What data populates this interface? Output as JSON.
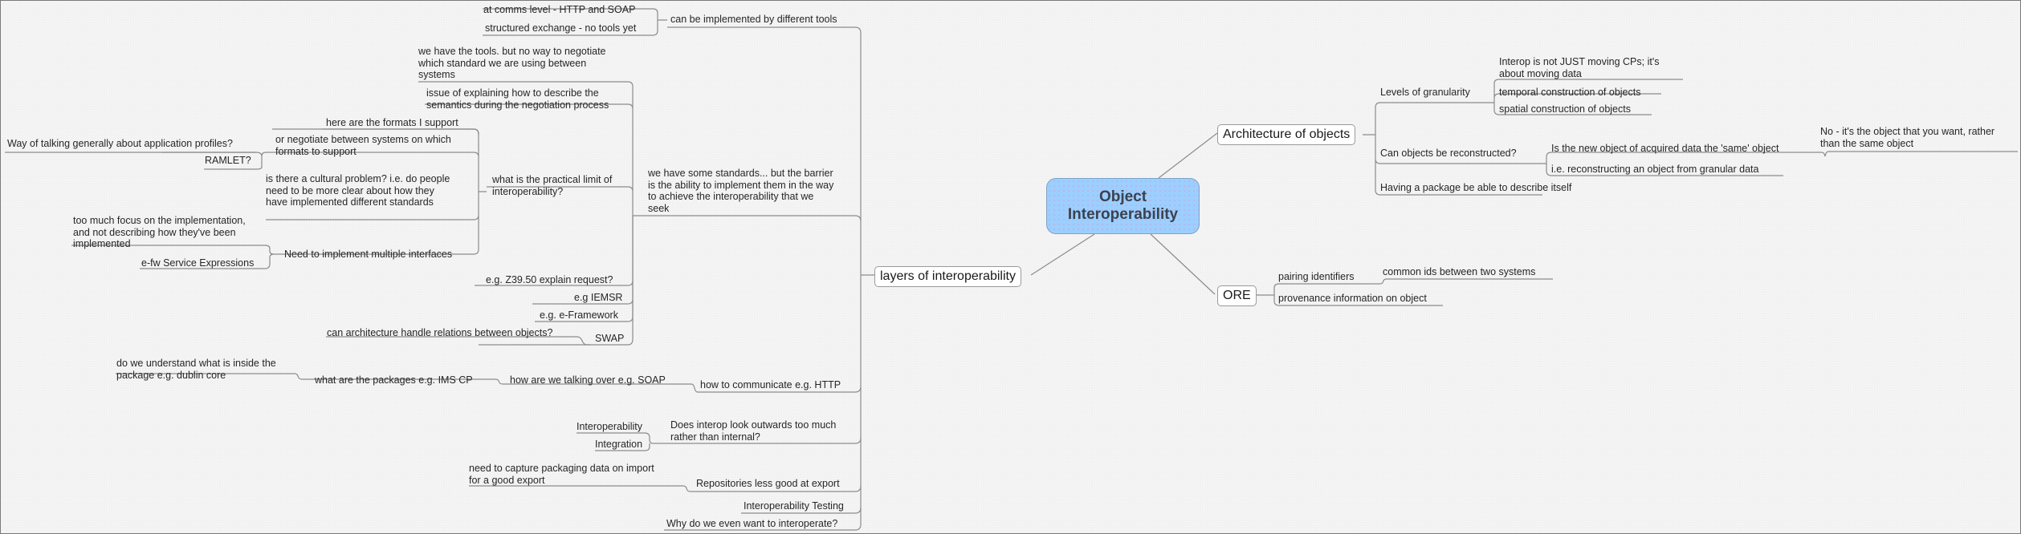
{
  "central": {
    "line1": "Object",
    "line2": "Interoperability"
  },
  "branches": {
    "layers": {
      "label": "layers of interoperability",
      "tools": {
        "label": "can be implemented by different tools",
        "children": [
          "at comms level - HTTP and SOAP",
          "structured exchange - no tools yet"
        ]
      },
      "standards": {
        "label": "we have some standards... but the barrier\nis the ability to implement them in the way\nto achieve the interoperability that we\nseek",
        "practical_limit": {
          "label": "what is the practical limit of\ninteroperability?",
          "negotiate_tools": "we have the tools. but no way to negotiate\nwhich standard we are using between\nsystems",
          "semantics": "issue of explaining how to describe the\nsemantics during the negotiation process",
          "formats": "here are the formats I support",
          "negotiate_formats": {
            "label": "or negotiate between systems on which\nformats to support",
            "children": [
              "Way of talking generally about application profiles?",
              "RAMLET?"
            ]
          },
          "cultural": "is there a cultural problem? i.e. do people\nneed to be more clear about how they\nhave implemented different standards",
          "multiple_interfaces": {
            "label": "Need to implement multiple interfaces",
            "children": [
              "too much focus on the implementation,\nand not describing how they've been\nimplemented",
              "e-fw Service Expressions"
            ]
          }
        },
        "examples": [
          "e.g. Z39.50 explain request?",
          "e.g IEMSR",
          "e.g. e-Framework"
        ],
        "swap": {
          "label": "SWAP",
          "child": "can architecture handle relations between objects?"
        }
      },
      "communicate": {
        "label": "how to communicate e.g. HTTP",
        "talking": "how are we talking over e.g. SOAP",
        "packages": "what are the packages e.g. IMS CP",
        "inside": "do we understand what is inside the\npackage e.g. dublin core"
      },
      "outwards": {
        "label": "Does interop look outwards too much\nrather than internal?",
        "children": [
          "Interoperability",
          "Integration"
        ]
      },
      "repositories": {
        "label": "Repositories less good at export",
        "child": "need to capture packaging data on import\nfor a good export"
      },
      "testing": "Interoperability Testing",
      "why": "Why do we even want to interoperate?"
    },
    "architecture": {
      "label": "Architecture of objects",
      "granularity": {
        "label": "Levels of granularity",
        "children": [
          "Interop is not JUST moving CPs; it's\nabout moving data",
          "temporal construction of objects",
          "spatial construction of objects"
        ]
      },
      "reconstructed": {
        "label": "Can objects be reconstructed?",
        "same": "Is the new object of acquired data the 'same' object",
        "same_answer": "No - it's the object that you want, rather\nthan the same object",
        "granular": "i.e. reconstructing an object from granular data"
      },
      "package": "Having a package be able to describe itself"
    },
    "ore": {
      "label": "ORE",
      "pairing": "pairing identifiers",
      "common_ids": "common ids between two systems",
      "provenance": "provenance information on object"
    }
  },
  "colors": {
    "central_fill": "#9ccfff",
    "line": "#8c8c8c",
    "background": "#f2f2f2"
  }
}
